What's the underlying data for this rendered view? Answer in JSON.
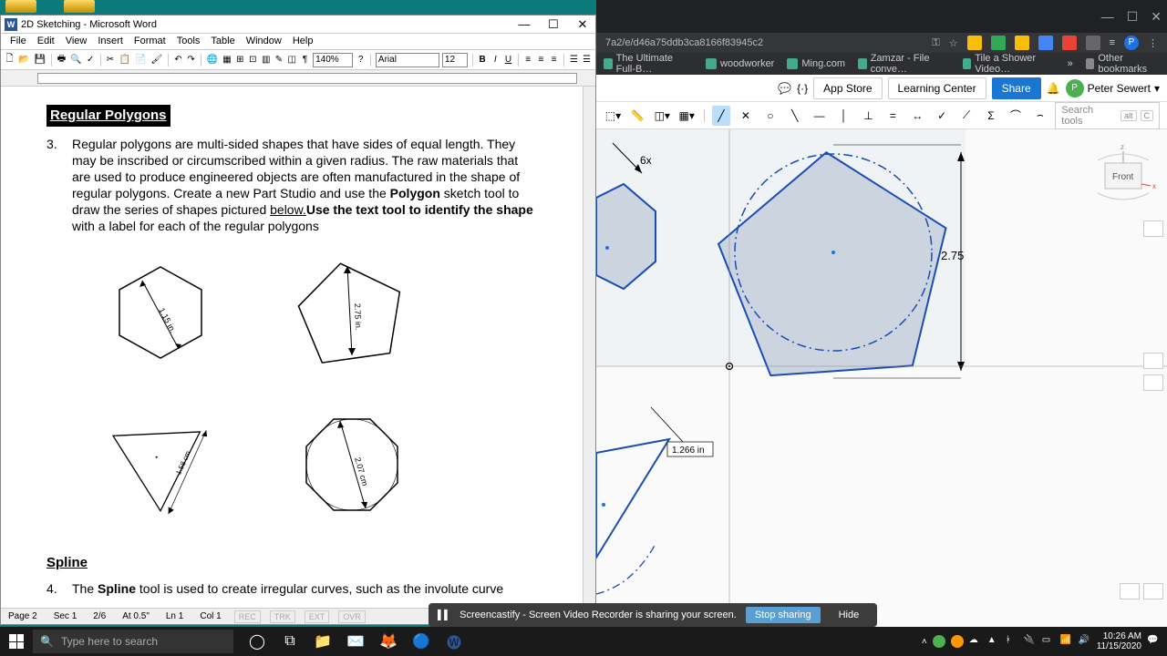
{
  "word": {
    "title": "2D Sketching - Microsoft Word",
    "menu": [
      "File",
      "Edit",
      "View",
      "Insert",
      "Format",
      "Tools",
      "Table",
      "Window",
      "Help"
    ],
    "zoom": "140%",
    "font": "Arial",
    "fontsize": "12",
    "status": {
      "page": "Page  2",
      "sec": "Sec  1",
      "pages": "2/6",
      "at": "At  0.5\"",
      "ln": "Ln  1",
      "col": "Col  1",
      "toggles": [
        "REC",
        "TRK",
        "EXT",
        "OVR"
      ]
    }
  },
  "doc": {
    "h1": "Regular Polygons",
    "p3num": "3.",
    "p3a": "Regular polygons are multi-sided shapes that have sides of equal length. They may be inscribed or circumscribed within a given radius. The raw materials that are used to produce engineered objects are often manufactured in the shape of regular polygons. Create a new Part Studio and use the ",
    "p3b": "Polygon",
    "p3c": " sketch tool to draw the series of shapes pictured ",
    "p3d": "below.",
    "p3e": "Use the text tool to identify the shape",
    "p3f": " with a label for each of the regular polygons",
    "dim_hex": "1.15 in.",
    "dim_pent": "2.75 in.",
    "dim_tri": "1.58 cm",
    "dim_oct": "2.07 cm",
    "h2": "Spline",
    "p4num": "4.",
    "p4a": "The ",
    "p4b": "Spline",
    "p4c": " tool is used to create irregular curves, such as the involute curve"
  },
  "browser": {
    "url": "7a2/e/d46a75ddb3ca8166f83945c2",
    "bookmarks": [
      "The Ultimate Full-B…",
      "woodworker",
      "Ming.com",
      "Zamzar - File conve…",
      "Tile a Shower Video…"
    ],
    "other_bm": "Other bookmarks"
  },
  "onshape": {
    "app_store": "App Store",
    "learning": "Learning Center",
    "share": "Share",
    "user": "Peter Sewert",
    "search_ph": "Search tools",
    "search_kbd1": "alt",
    "search_kbd2": "C",
    "dim_6x": "6x",
    "dim_275": "2.75",
    "dim_1266": "1.266 in",
    "view": "Front"
  },
  "screencastify": {
    "msg": "Screencastify - Screen Video Recorder is sharing your screen.",
    "stop": "Stop sharing",
    "hide": "Hide"
  },
  "taskbar": {
    "search_ph": "Type here to search",
    "time": "10:26 AM",
    "date": "11/15/2020"
  }
}
